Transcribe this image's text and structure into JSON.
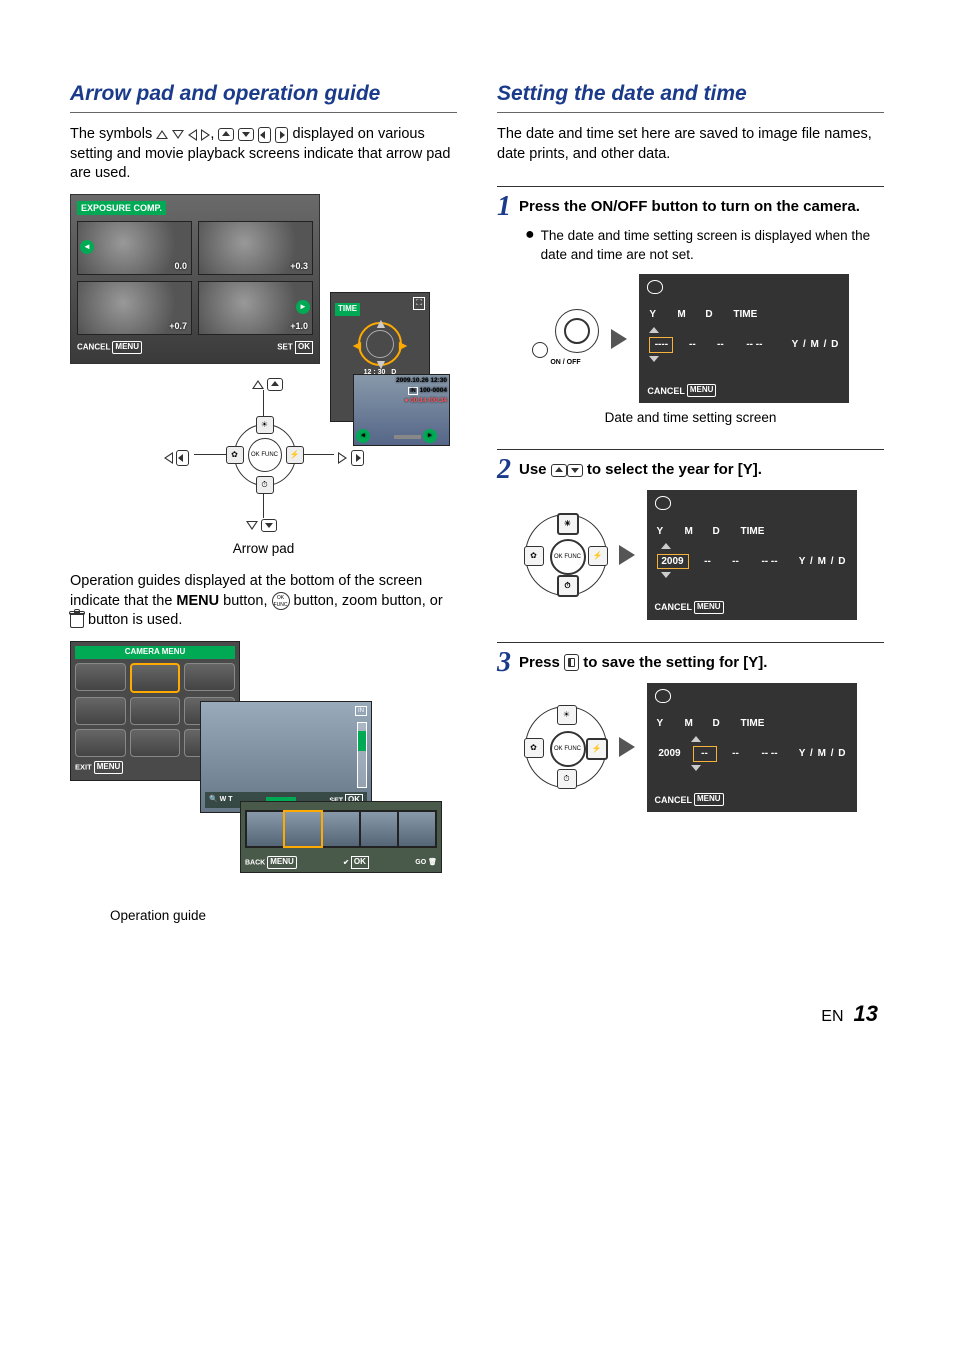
{
  "page": {
    "lang": "EN",
    "number": "13"
  },
  "left": {
    "title": "Arrow pad and operation guide",
    "intro_pre": "The symbols ",
    "intro_post": " displayed on various setting and movie playback screens indicate that arrow pad are used.",
    "exposure": {
      "title": "EXPOSURE COMP.",
      "vals": [
        "0.0",
        "+0.3",
        "+0.7",
        "+1.0"
      ],
      "cancel": "CANCEL",
      "set": "SET",
      "ok": "OK",
      "menu": "MENU"
    },
    "time_panel": {
      "title": "TIME",
      "value": "12 : 30",
      "date_order": "D"
    },
    "playback_info": {
      "date": "2009.10.26 12:30",
      "file": "100-0004",
      "in_label": "IN",
      "clip": "00:14 /00:34"
    },
    "pad_caption": "Arrow pad",
    "pad_center": "OK\nFUNC",
    "op_guide_pre": "Operation guides displayed at the bottom of the screen indicate that the ",
    "menu_word": "MENU",
    "op_guide_mid1": " button, ",
    "op_guide_mid2": " button, zoom button, or ",
    "op_guide_post": " button is used.",
    "camera_menu": {
      "title": "CAMERA MENU",
      "exit": "EXIT",
      "set": "SET",
      "ok": "OK",
      "menu": "MENU"
    },
    "thumb_playback": {
      "wt": "W T",
      "set": "SET",
      "ok": "OK",
      "in": "IN"
    },
    "strip": {
      "back": "BACK",
      "menu": "MENU",
      "ok": "OK",
      "go": "GO"
    },
    "op_guide_caption": "Operation guide"
  },
  "right": {
    "title": "Setting the date and time",
    "intro": "The date and time set here are saved to image file names, date prints, and other data.",
    "step1": {
      "num": "1",
      "text_pre": "Press the ",
      "onoff": "ON/OFF",
      "text_post": " button to turn on the camera.",
      "note": "The date and time setting screen is displayed when the date and time are not set.",
      "onoff_small": "ON / OFF"
    },
    "step2": {
      "num": "2",
      "text_pre": "Use ",
      "text_post": " to select the year for [Y]."
    },
    "step3": {
      "num": "3",
      "text_pre": "Press ",
      "text_post": " to save the setting for [Y]."
    },
    "screen_common": {
      "Y": "Y",
      "M": "M",
      "D": "D",
      "TIME": "TIME",
      "format": "Y / M / D",
      "cancel": "CANCEL",
      "menu": "MENU",
      "dashes4": "----",
      "dashes2": "--",
      "time_dashes": "-- --",
      "year": "2009"
    },
    "screen1_caption": "Date and time setting screen",
    "mini_pad_center": "OK\nFUNC"
  }
}
